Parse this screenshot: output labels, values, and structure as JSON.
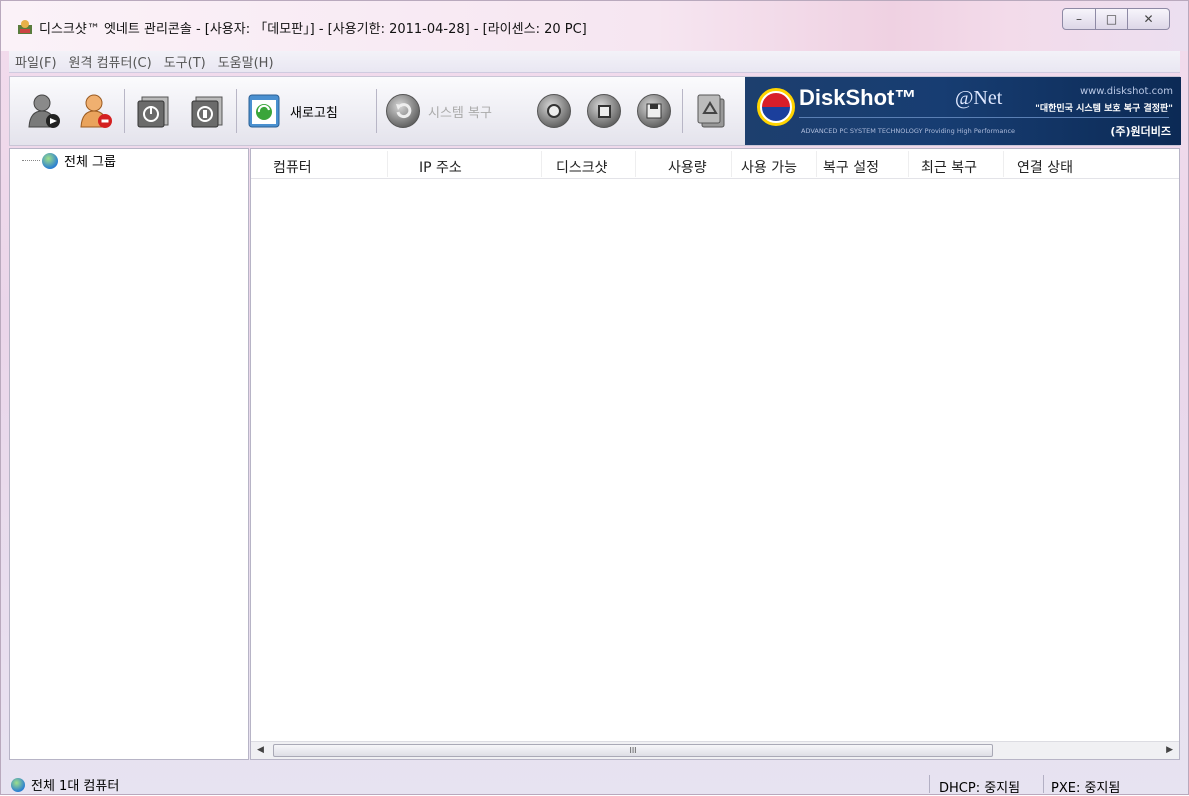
{
  "window": {
    "title": "디스크샷™ 엣네트 관리콘솔 - [사용자: 「데모판」] - [사용기한: 2011-04-28] - [라이센스: 20 PC]",
    "controls": {
      "minimize": "–",
      "maximize": "□",
      "close": "✕"
    }
  },
  "menu": {
    "items": [
      "파일(F)",
      "원격 컴퓨터(C)",
      "도구(T)",
      "도움말(H)"
    ]
  },
  "toolbar": {
    "refresh_label": "새로고침",
    "restore_label": "시스템 복구",
    "icons": [
      "user-add-icon",
      "user-remove-icon",
      "power-on-icon",
      "power-off-icon",
      "refresh-icon",
      "system-restore-icon",
      "record-icon",
      "stop-icon",
      "save-icon",
      "recycle-icon"
    ]
  },
  "banner": {
    "brand": "DiskShot™",
    "at_net": "@Net",
    "url": "www.diskshot.com",
    "slogan": "\"대한민국 시스템 보호 복구 결정판\"",
    "tagline": "ADVANCED PC SYSTEM TECHNOLOGY Providing High Performance",
    "company": "(주)원더비즈"
  },
  "tree": {
    "root_label": "전체 그룹"
  },
  "list": {
    "columns": [
      "컴퓨터",
      "IP 주소",
      "디스크샷",
      "사용량",
      "사용 가능",
      "복구 설정",
      "최근 복구",
      "연결 상태"
    ]
  },
  "scrollbar": {
    "grip": "III"
  },
  "status": {
    "summary": "전체 1대 컴퓨터",
    "dhcp": "DHCP: 중지됨",
    "pxe": "PXE: 중지됨"
  },
  "colors": {
    "banner_bg": "#173d72",
    "title_bg": "#f6e6f1"
  }
}
